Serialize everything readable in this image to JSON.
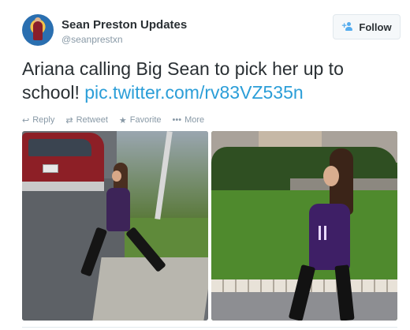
{
  "tweet": {
    "author": {
      "display_name": "Sean Preston Updates",
      "handle": "@seanprestxn"
    },
    "follow_label": "Follow",
    "text_main": "Ariana calling Big Sean to pick her up to school!",
    "text_link": "pic.twitter.com/rv83VZ535n",
    "actions": {
      "reply": "Reply",
      "retweet": "Retweet",
      "favorite": "Favorite",
      "more": "More"
    }
  },
  "colors": {
    "link": "#2b9ed8",
    "meta": "#8899a6",
    "follow_icon": "#55acee"
  },
  "icons": [
    "reply-icon",
    "retweet-icon",
    "favorite-icon",
    "more-icon",
    "follow-person-icon"
  ]
}
